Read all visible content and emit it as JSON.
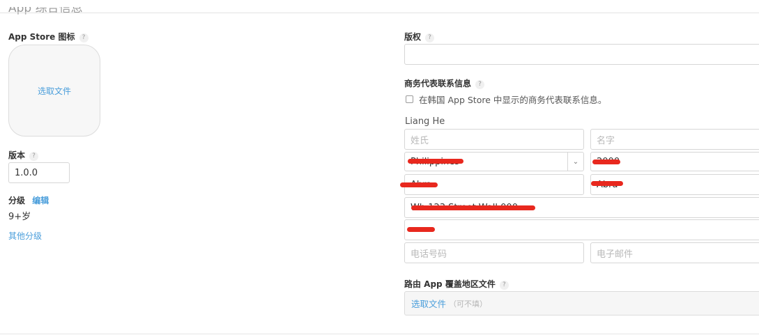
{
  "section": {
    "title": "App 综合信息"
  },
  "left": {
    "icon": {
      "label": "App Store 图标",
      "help": "?",
      "choose": "选取文件"
    },
    "version": {
      "label": "版本",
      "help": "?",
      "value": "1.0.0"
    },
    "rating": {
      "label": "分级",
      "edit": "编辑",
      "value": "9+岁",
      "other": "其他分级"
    }
  },
  "right": {
    "copyright": {
      "label": "版权",
      "help": "?",
      "value": ""
    },
    "contact": {
      "label": "商务代表联系信息",
      "help": "?",
      "checkbox_label": "在韩国 App Store 中显示的商务代表联系信息。",
      "checked": false,
      "name": "Liang He",
      "last_name_placeholder": "姓氏",
      "first_name_placeholder": "名字",
      "country": "Philippines",
      "postal_code": "2000",
      "city": "Abra",
      "state": "Abra",
      "address1": "Wh 123 Street Wall 000",
      "address2": "",
      "phone_placeholder": "电话号码",
      "email_placeholder": "电子邮件"
    },
    "routing": {
      "label": "路由 App 覆盖地区文件",
      "help": "?",
      "choose": "选取文件",
      "optional": "（可不填）"
    }
  },
  "colors": {
    "link": "#4a9edb",
    "redaction": "#e8281e"
  }
}
